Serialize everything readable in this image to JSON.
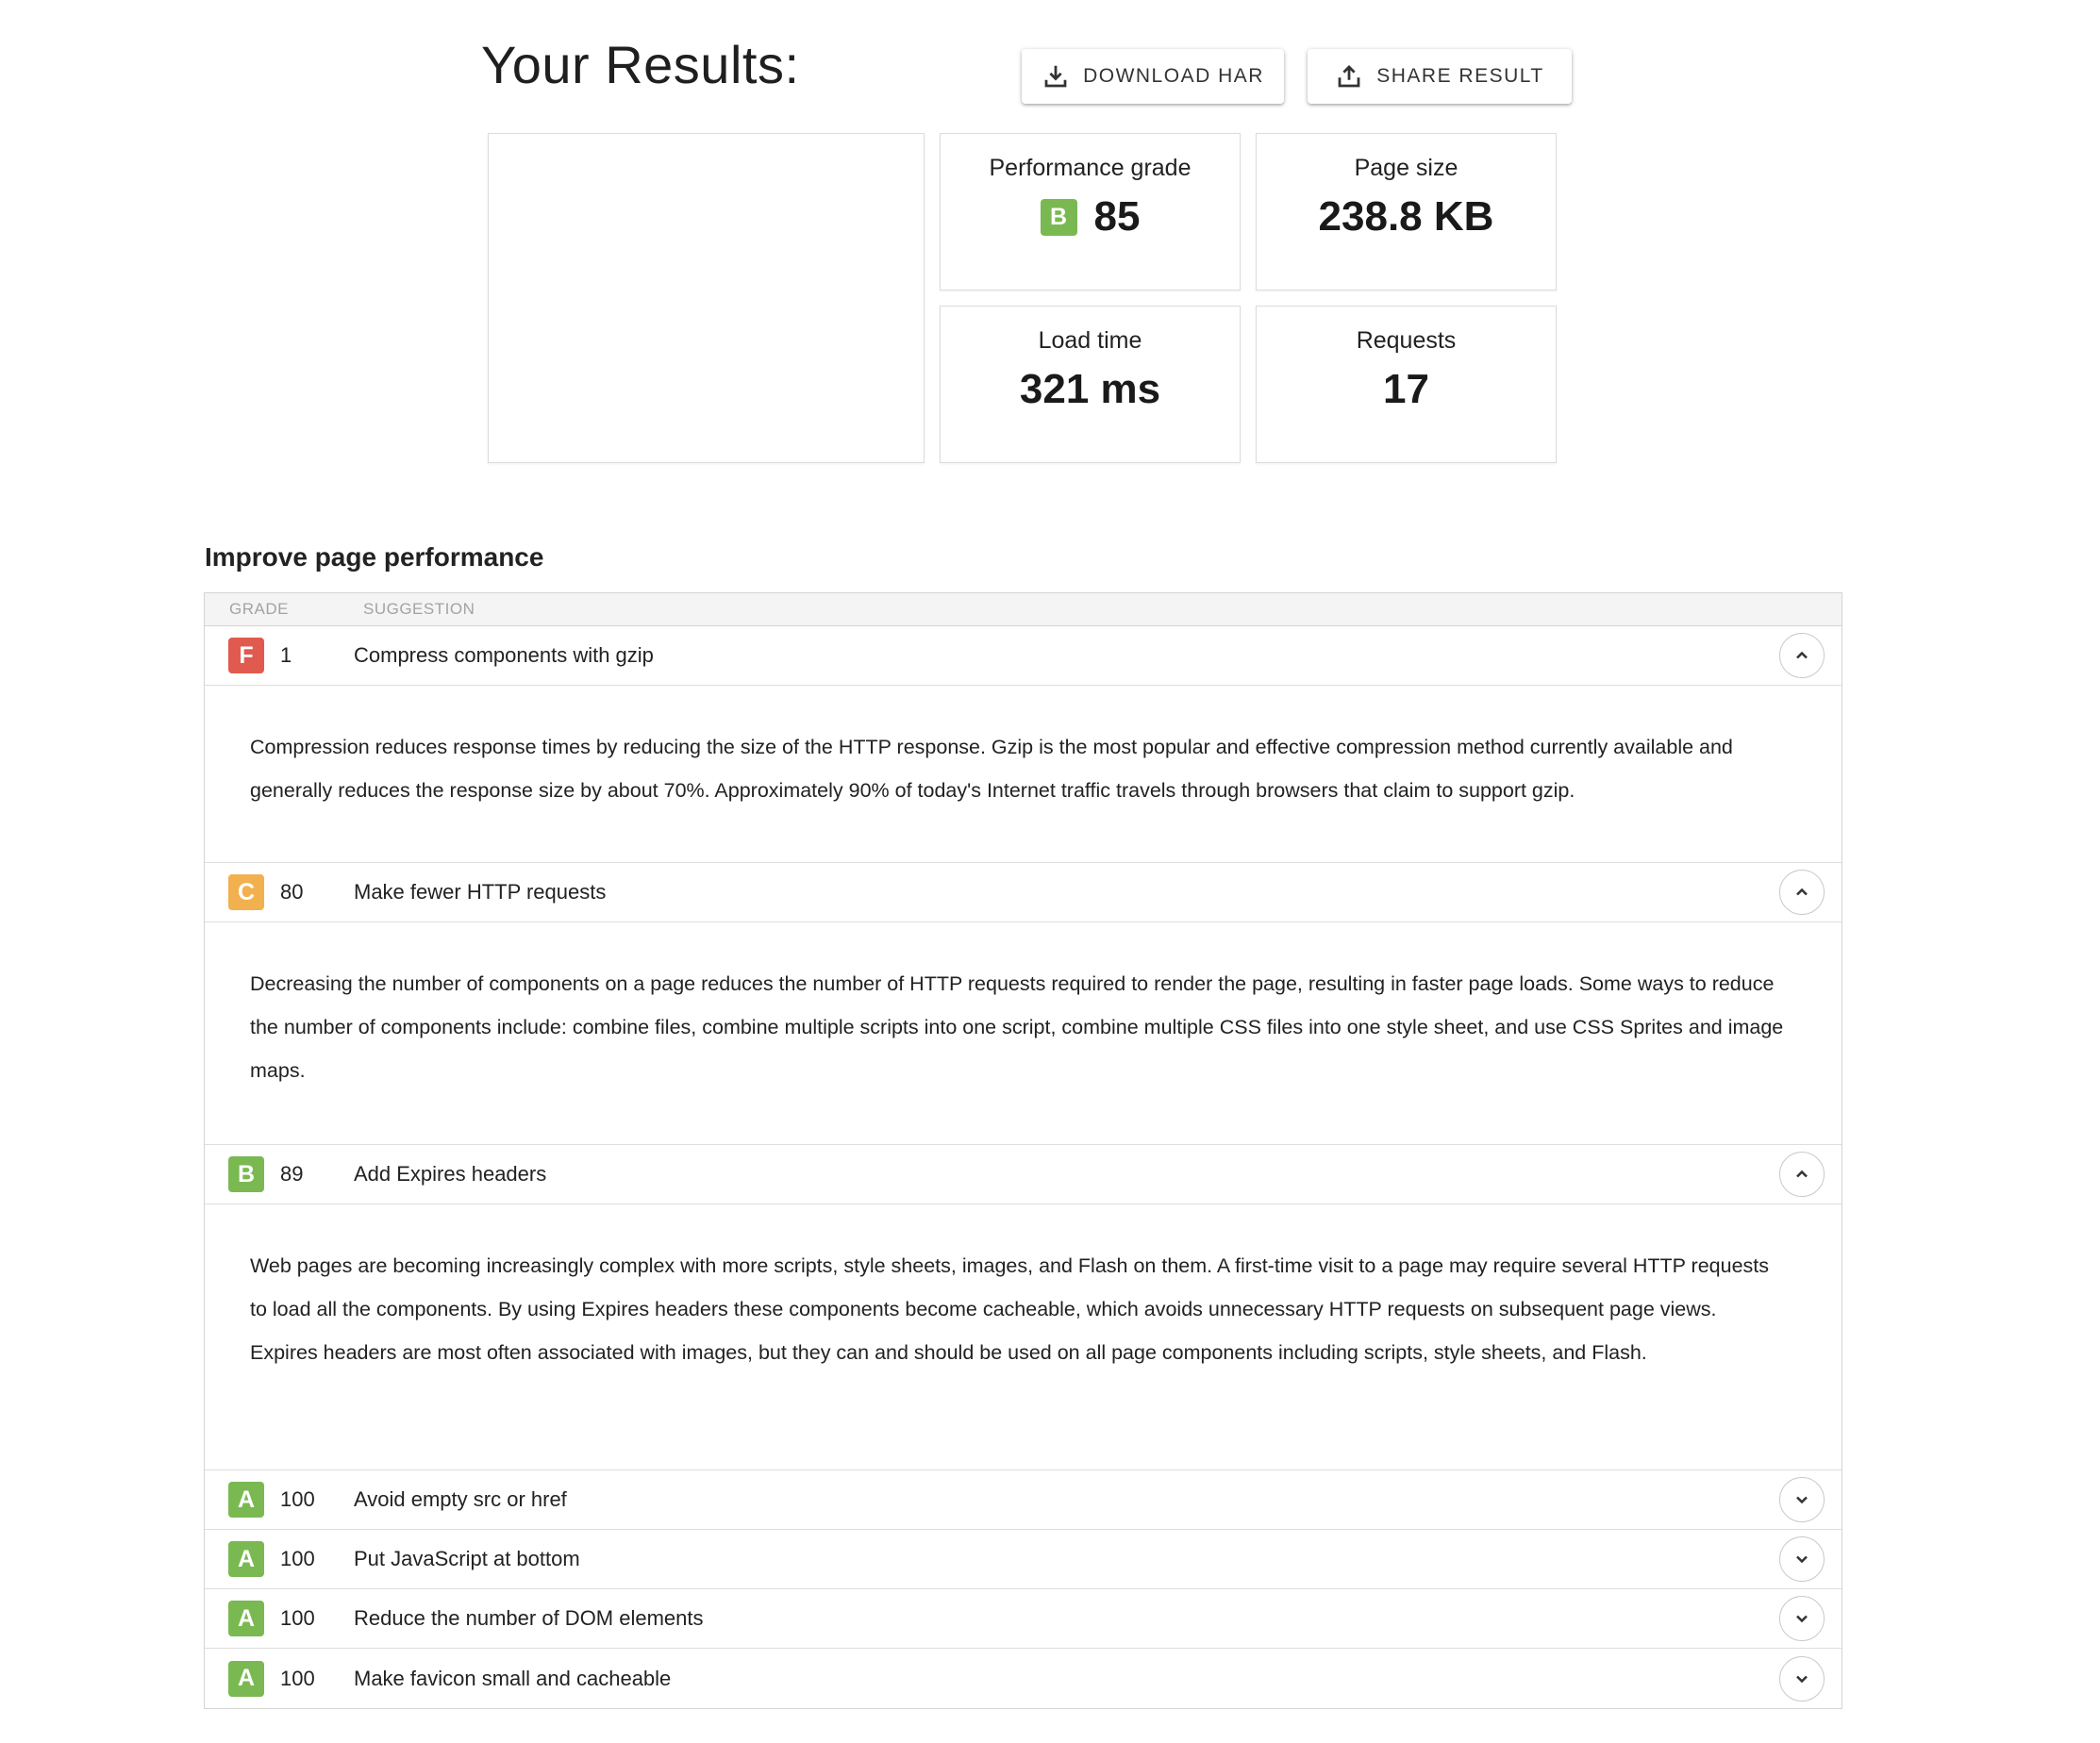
{
  "header": {
    "title": "Your Results:",
    "download_label": "DOWNLOAD HAR",
    "share_label": "SHARE RESULT"
  },
  "metrics": {
    "grade": {
      "label": "Performance grade",
      "letter": "B",
      "value": "85"
    },
    "size": {
      "label": "Page size",
      "value": "238.8 KB"
    },
    "load": {
      "label": "Load time",
      "value": "321 ms"
    },
    "requests": {
      "label": "Requests",
      "value": "17"
    }
  },
  "colors": {
    "grade_a": "#7ab951",
    "grade_b": "#7ab951",
    "grade_c": "#f2b04e",
    "grade_f": "#e05a4f"
  },
  "suggestions": {
    "title": "Improve page performance",
    "columns": {
      "grade": "GRADE",
      "suggestion": "SUGGESTION"
    },
    "items": [
      {
        "grade": "F",
        "score": "1",
        "title": "Compress components with gzip",
        "expanded": true,
        "detail": "Compression reduces response times by reducing the size of the HTTP response. Gzip is the most popular and effective compression method currently available and generally reduces the response size by about 70%. Approximately 90% of today's Internet traffic travels through browsers that claim to support gzip."
      },
      {
        "grade": "C",
        "score": "80",
        "title": "Make fewer HTTP requests",
        "expanded": true,
        "detail": "Decreasing the number of components on a page reduces the number of HTTP requests required to render the page, resulting in faster page loads. Some ways to reduce the number of components include: combine files, combine multiple scripts into one script, combine multiple CSS files into one style sheet, and use CSS Sprites and image maps."
      },
      {
        "grade": "B",
        "score": "89",
        "title": "Add Expires headers",
        "expanded": true,
        "detail": "Web pages are becoming increasingly complex with more scripts, style sheets, images, and Flash on them. A first-time visit to a page may require several HTTP requests to load all the components. By using Expires headers these components become cacheable, which avoids unnecessary HTTP requests on subsequent page views. Expires headers are most often associated with images, but they can and should be used on all page components including scripts, style sheets, and Flash."
      },
      {
        "grade": "A",
        "score": "100",
        "title": "Avoid empty src or href",
        "expanded": false
      },
      {
        "grade": "A",
        "score": "100",
        "title": "Put JavaScript at bottom",
        "expanded": false
      },
      {
        "grade": "A",
        "score": "100",
        "title": "Reduce the number of DOM elements",
        "expanded": false
      },
      {
        "grade": "A",
        "score": "100",
        "title": "Make favicon small and cacheable",
        "expanded": false
      }
    ]
  }
}
